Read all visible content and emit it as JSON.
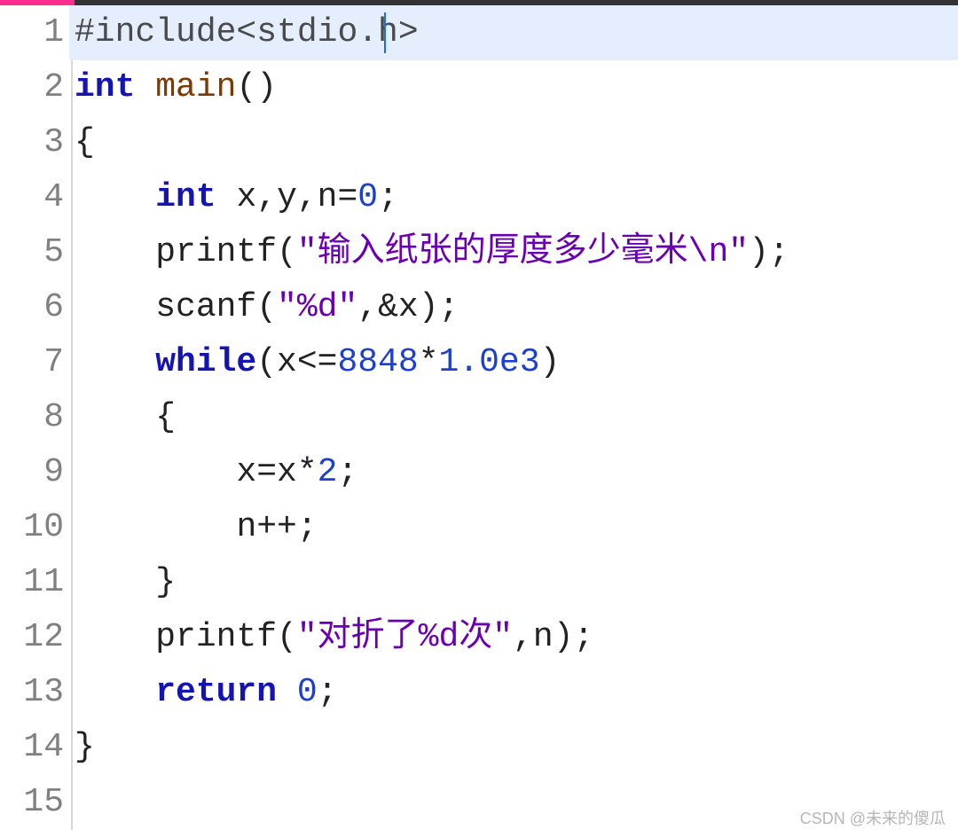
{
  "lineNumbers": [
    "1",
    "2",
    "3",
    "4",
    "5",
    "6",
    "7",
    "8",
    "9",
    "10",
    "11",
    "12",
    "13",
    "14",
    "15"
  ],
  "tokens": {
    "l1": {
      "pre": "#include<stdio.h>"
    },
    "l2": {
      "kw": "int",
      "sp": " ",
      "fn": "main",
      "paren": "()"
    },
    "l3": {
      "brace": "{"
    },
    "l4": {
      "indent": "    ",
      "kw": "int",
      "sp": " ",
      "id1": "x",
      "punc1": ",y,n=",
      "num": "0",
      "punc2": ";"
    },
    "l5": {
      "indent": "    ",
      "call": "printf(",
      "q1": "\"",
      "str": "输入纸张的厚度多少毫米\\n",
      "q2": "\"",
      "close": ");"
    },
    "l6": {
      "indent": "    ",
      "call": "scanf(",
      "q1": "\"",
      "str": "%d",
      "q2": "\"",
      "rest": ",&x);"
    },
    "l7": {
      "indent": "    ",
      "kw": "while",
      "open": "(x<=",
      "num1": "8848",
      "star": "*",
      "num2": "1.0e3",
      "close": ")"
    },
    "l8": {
      "indent": "    ",
      "brace": "{"
    },
    "l9": {
      "indent": "        ",
      "expr1": "x=x*",
      "num": "2",
      "semi": ";"
    },
    "l10": {
      "indent": "        ",
      "expr": "n++;"
    },
    "l11": {
      "indent": "    ",
      "brace": "}"
    },
    "l12": {
      "indent": "    ",
      "call": "printf(",
      "q1": "\"",
      "str": "对折了%d次",
      "q2": "\"",
      "rest": ",n);"
    },
    "l13": {
      "indent": "    ",
      "kw": "return",
      "sp": " ",
      "num": "0",
      "semi": ";"
    },
    "l14": {
      "brace": "}"
    },
    "l15": {
      "empty": ""
    }
  },
  "watermark": "CSDN @未来的傻瓜"
}
